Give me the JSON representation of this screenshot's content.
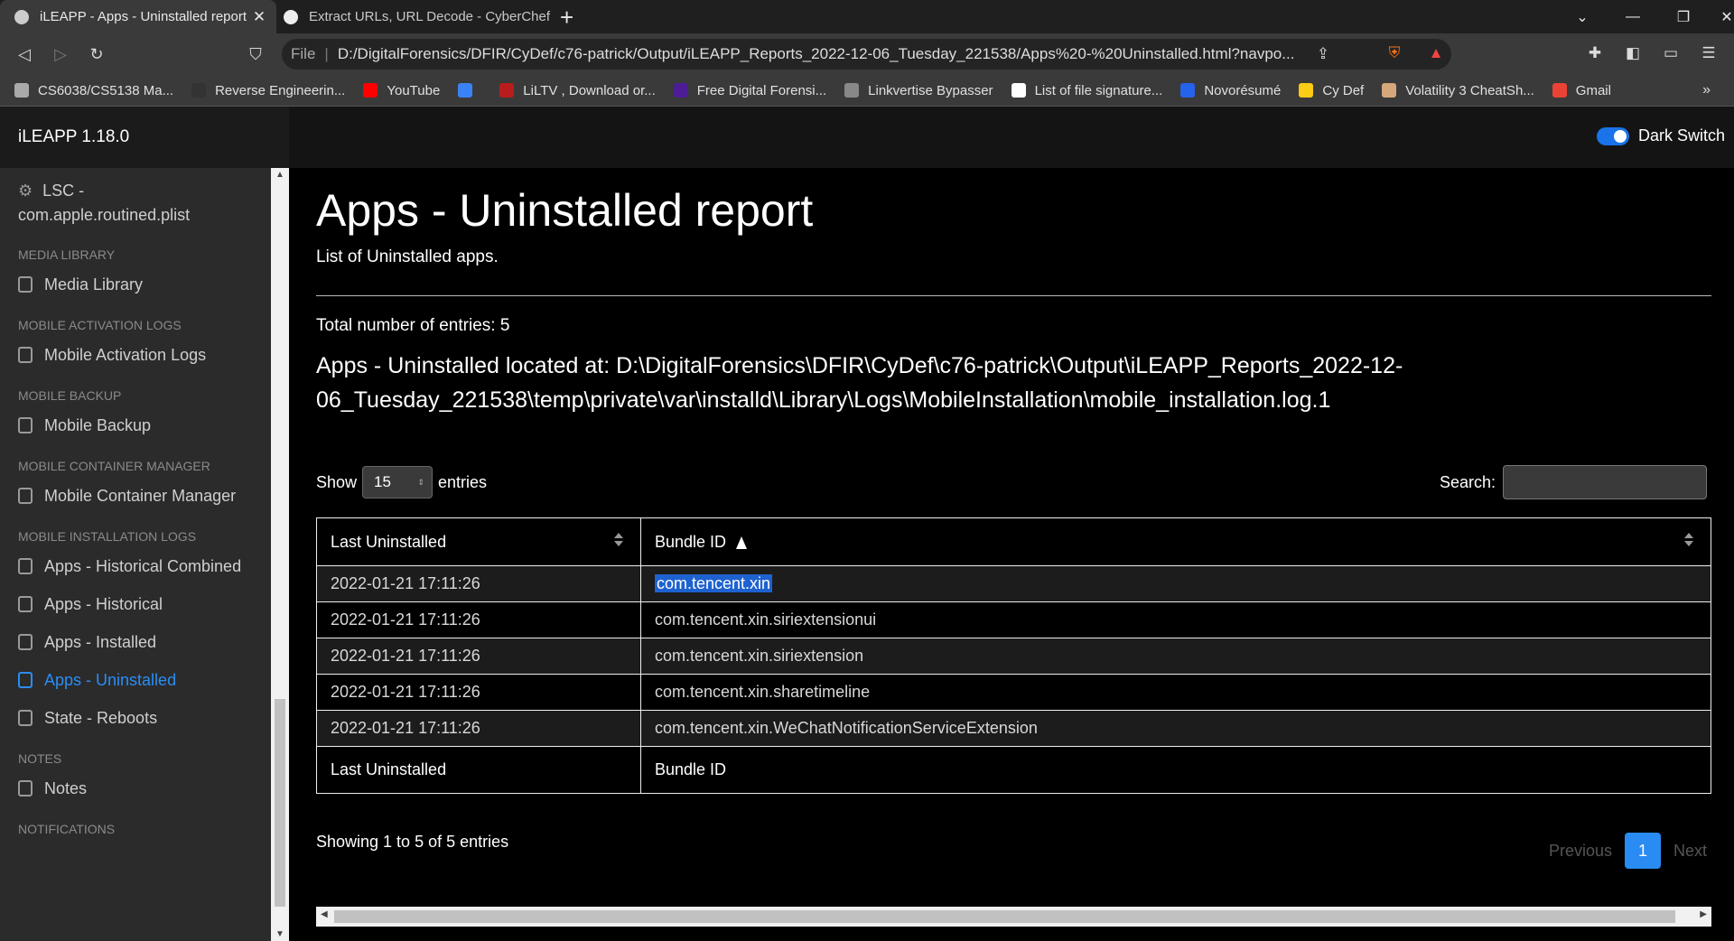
{
  "browser": {
    "tabs": [
      {
        "title": "iLEAPP - Apps - Uninstalled report",
        "close": "✕"
      },
      {
        "title": "Extract URLs, URL Decode - CyberChef"
      }
    ],
    "new_tab": "+",
    "address": {
      "scheme_label": "File",
      "info": "i",
      "url": "D:/DigitalForensics/DFIR/CyDef/c76-patrick/Output/iLEAPP_Reports_2022-12-06_Tuesday_221538/Apps%20-%20Uninstalled.html?navpo..."
    },
    "bookmarks": [
      {
        "label": "CS6038/CS5138 Ma...",
        "color": "#aaaaaa"
      },
      {
        "label": "Reverse Engineerin...",
        "color": "#333333"
      },
      {
        "label": "YouTube",
        "color": "#ff0000"
      },
      {
        "label": "",
        "color": "#3b82f6"
      },
      {
        "label": "LiLTV , Download or...",
        "color": "#b91c1c"
      },
      {
        "label": "Free Digital Forensi...",
        "color": "#4c1d95"
      },
      {
        "label": "Linkvertise Bypasser",
        "color": "#888888"
      },
      {
        "label": "List of file signature...",
        "color": "#ffffff"
      },
      {
        "label": "Novorésumé",
        "color": "#2563eb"
      },
      {
        "label": "Cy Def",
        "color": "#facc15"
      },
      {
        "label": "Volatility 3 CheatSh...",
        "color": "#d6a77a"
      },
      {
        "label": "Gmail",
        "color": "#ea4335"
      }
    ],
    "bookmarks_more": "»"
  },
  "app": {
    "brand": "iLEAPP 1.18.0",
    "dark_switch_label": "Dark Switch"
  },
  "sidebar": {
    "top_item_line1": "LSC -",
    "top_item_line2": "com.apple.routined.plist",
    "sections": [
      {
        "heading": "MEDIA LIBRARY",
        "items": [
          "Media Library"
        ]
      },
      {
        "heading": "MOBILE ACTIVATION LOGS",
        "items": [
          "Mobile Activation Logs"
        ]
      },
      {
        "heading": "MOBILE BACKUP",
        "items": [
          "Mobile Backup"
        ]
      },
      {
        "heading": "MOBILE CONTAINER MANAGER",
        "items": [
          "Mobile Container Manager"
        ]
      },
      {
        "heading": "MOBILE INSTALLATION LOGS",
        "items": [
          "Apps - Historical Combined",
          "Apps - Historical",
          "Apps - Installed",
          "Apps - Uninstalled",
          "State - Reboots"
        ]
      },
      {
        "heading": "NOTES",
        "items": [
          "Notes"
        ]
      },
      {
        "heading": "NOTIFICATIONS",
        "items": []
      }
    ],
    "active_item": "Apps - Uninstalled"
  },
  "report": {
    "title": "Apps - Uninstalled report",
    "subtitle": "List of Uninstalled apps.",
    "total": "Total number of entries: 5",
    "located": "Apps - Uninstalled located at: D:\\DigitalForensics\\DFIR\\CyDef\\c76-patrick\\Output\\iLEAPP_Reports_2022-12-06_Tuesday_221538\\temp\\private\\var\\installd\\Library\\Logs\\MobileInstallation\\mobile_installation.log.1",
    "show_label": "Show",
    "show_value": "15",
    "entries_label": "entries",
    "search_label": "Search:",
    "columns": [
      "Last Uninstalled",
      "Bundle ID"
    ],
    "rows": [
      [
        "2022-01-21 17:11:26",
        "com.tencent.xin"
      ],
      [
        "2022-01-21 17:11:26",
        "com.tencent.xin.siriextensionui"
      ],
      [
        "2022-01-21 17:11:26",
        "com.tencent.xin.siriextension"
      ],
      [
        "2022-01-21 17:11:26",
        "com.tencent.xin.sharetimeline"
      ],
      [
        "2022-01-21 17:11:26",
        "com.tencent.xin.WeChatNotificationServiceExtension"
      ]
    ],
    "info": "Showing 1 to 5 of 5 entries",
    "pager": {
      "previous": "Previous",
      "page": "1",
      "next": "Next"
    }
  }
}
